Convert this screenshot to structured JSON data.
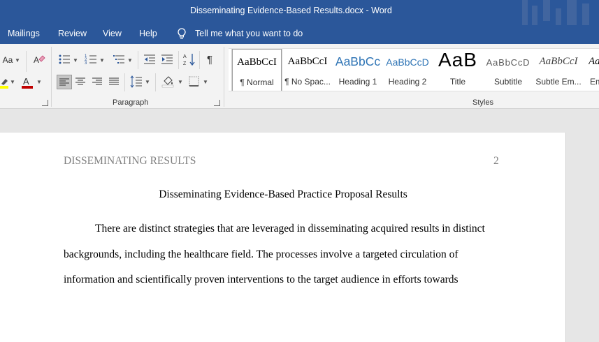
{
  "window": {
    "title": "Disseminating Evidence-Based Results.docx  -  Word"
  },
  "menu": {
    "mailings": "Mailings",
    "review": "Review",
    "view": "View",
    "help": "Help",
    "tell_me": "Tell me what you want to do"
  },
  "ribbon": {
    "font_size_change": "Aa",
    "paragraph_label": "Paragraph",
    "styles_label": "Styles",
    "styles": [
      {
        "sample": "AaBbCcI",
        "name": "¶ Normal"
      },
      {
        "sample": "AaBbCcI",
        "name": "¶ No Spac..."
      },
      {
        "sample": "AaBbCc",
        "name": "Heading 1"
      },
      {
        "sample": "AaBbCcD",
        "name": "Heading 2"
      },
      {
        "sample": "AaB",
        "name": "Title"
      },
      {
        "sample": "AaBbCcD",
        "name": "Subtitle"
      },
      {
        "sample": "AaBbCcI",
        "name": "Subtle Em..."
      },
      {
        "sample": "Aa",
        "name": "Em"
      }
    ],
    "colors": {
      "highlight": "#ffff00",
      "font_color": "#c00000",
      "accent": "#2b579a"
    }
  },
  "document": {
    "running_head": "DISSEMINATING RESULTS",
    "page_number": "2",
    "title": "Disseminating Evidence-Based Practice Proposal Results",
    "lines": [
      "There are distinct strategies that are leveraged in disseminating acquired results in distinct",
      "backgrounds, including the healthcare field. The processes involve a targeted circulation of",
      "information and scientifically proven interventions to the target audience in efforts towards"
    ]
  }
}
